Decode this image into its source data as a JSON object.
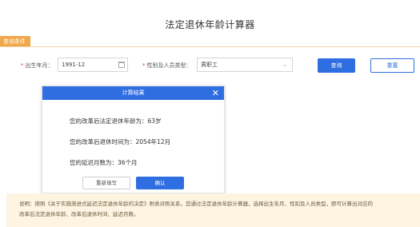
{
  "page": {
    "title": "法定退休年龄计算器"
  },
  "query_section": {
    "tab_label": "查询条件",
    "birth_label": "出生年月：",
    "birth_value": "1991-12",
    "type_label": "性别及人员类型：",
    "type_value": "男职工",
    "query_button": "查询",
    "reset_button": "重置"
  },
  "modal": {
    "title": "计算结果",
    "close_glyph": "✕",
    "retire_age": "您的改革后法定退休年龄为：63岁",
    "retire_time": "您的改革后退休时间为：2054年12月",
    "delay_months": "您的延迟月数为：36个月",
    "refill_button": "重新填写",
    "confirm_button": "确认"
  },
  "notice": {
    "line1": "说明：按照《关于实施渐进式延迟法定退休年龄的决定》附表对照关系，您通过法定退休年龄计算器，选择出生年月、性别及人员类型，即可计算出对应的",
    "line2": "改革后法定退休年龄、改革后退休时间、延迟月数。"
  },
  "colors": {
    "primary": "#2f6ee0",
    "tab_orange": "#f0a84a",
    "notice_bg": "#fdf4e2"
  }
}
